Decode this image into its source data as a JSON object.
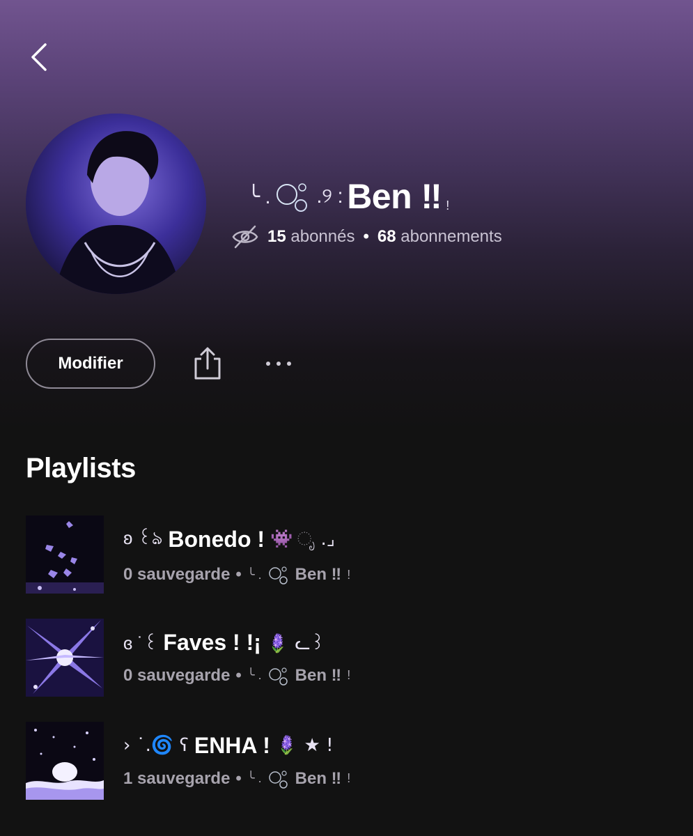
{
  "header": {
    "back_icon": "chevron-left-icon"
  },
  "profile": {
    "name_prefix": "╰ .",
    "name_bubble": "🫧",
    "name_swirl": " .୨ :",
    "name": "Ben ‼",
    "name_suffix": "!",
    "followers_count": "15",
    "followers_label": "abonnés",
    "separator": "•",
    "following_count": "68",
    "following_label": "abonnements",
    "privacy_icon": "eye-slash-icon"
  },
  "actions": {
    "edit_label": "Modifier",
    "share_icon": "share-icon",
    "more_icon": "more-dots-icon"
  },
  "section": {
    "title": "Playlists"
  },
  "playlists": [
    {
      "title_prefix": "ʚ ꒰ঌ",
      "title": "Bonedo !",
      "title_suffix": "👾 ೃ .⌟",
      "saves": "0 sauvegarde",
      "owner_prefix": "╰ .",
      "owner": "Ben ‼",
      "owner_suffix": "!"
    },
    {
      "title_prefix": "ɞ ˙꒰",
      "title": "Faves ! !¡",
      "title_suffix": "🪻 ᓚ꒱",
      "saves": "0 sauvegarde",
      "owner_prefix": "╰ .",
      "owner": "Ben ‼",
      "owner_suffix": "!"
    },
    {
      "title_prefix": "› ˙.🌀 ʕ",
      "title": "ENHA !",
      "title_suffix": "🪻 ★ !",
      "saves": "1 sauvegarde",
      "owner_prefix": "╰ .",
      "owner": "Ben ‼",
      "owner_suffix": "!"
    }
  ],
  "colors": {
    "header_gradient_top": "#71548f",
    "background": "#121212",
    "secondary_text": "#a7a3ad",
    "accent_purple": "#7a5fd6"
  }
}
